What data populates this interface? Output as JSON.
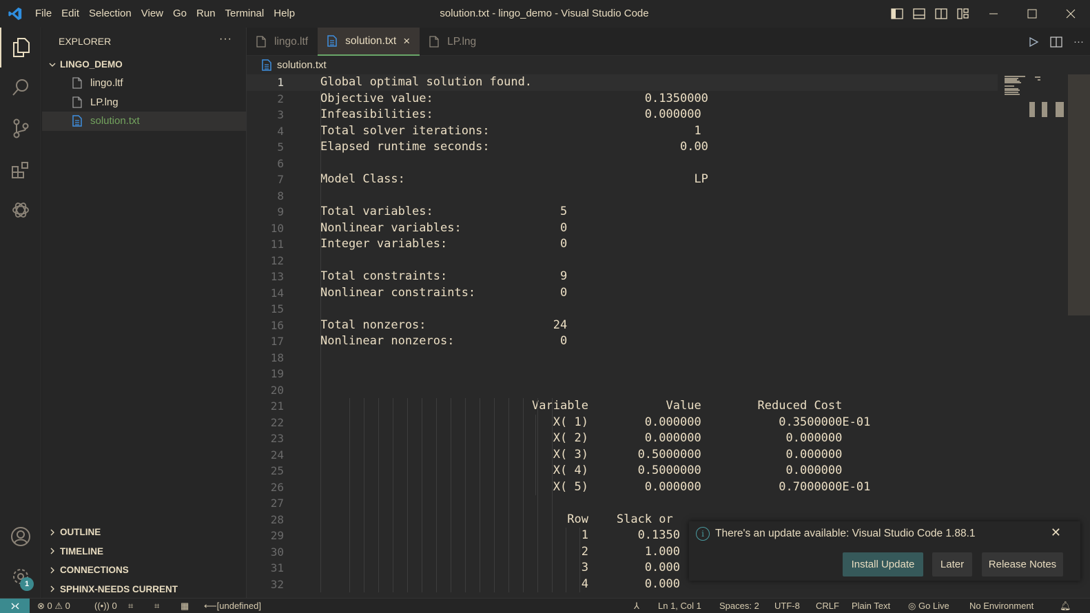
{
  "window": {
    "title": "solution.txt - lingo_demo - Visual Studio Code",
    "menu": [
      "File",
      "Edit",
      "Selection",
      "View",
      "Go",
      "Run",
      "Terminal",
      "Help"
    ]
  },
  "activity_bar": {
    "items": [
      "explorer-icon",
      "search-icon",
      "source-control-icon",
      "extensions-icon",
      "chatgpt-icon"
    ],
    "bottom": [
      "account-icon",
      "settings-gear-icon"
    ],
    "settings_badge": "1"
  },
  "sidebar": {
    "header": "EXPLORER",
    "more_label": "···",
    "folder": "LINGO_DEMO",
    "files": [
      {
        "name": "lingo.ltf",
        "selected": false
      },
      {
        "name": "LP.lng",
        "selected": false
      },
      {
        "name": "solution.txt",
        "selected": true
      }
    ],
    "sections": [
      "OUTLINE",
      "TIMELINE",
      "CONNECTIONS",
      "SPHINX-NEEDS CURRENT"
    ]
  },
  "tabs": [
    {
      "label": "lingo.ltf",
      "active": false
    },
    {
      "label": "solution.txt",
      "active": true,
      "close": "×"
    },
    {
      "label": "LP.lng",
      "active": false
    }
  ],
  "breadcrumb": "solution.txt",
  "editor": {
    "current_line": 1,
    "lines": [
      "Global optimal solution found.",
      "Objective value:                              0.1350000",
      "Infeasibilities:                              0.000000",
      "Total solver iterations:                             1",
      "Elapsed runtime seconds:                           0.00",
      "",
      "Model Class:                                         LP",
      "",
      "Total variables:                  5",
      "Nonlinear variables:              0",
      "Integer variables:                0",
      "",
      "Total constraints:                9",
      "Nonlinear constraints:            0",
      "",
      "Total nonzeros:                  24",
      "Nonlinear nonzeros:               0",
      "",
      "",
      "",
      "                              Variable           Value        Reduced Cost",
      "                                 X( 1)        0.000000           0.3500000E-01",
      "                                 X( 2)        0.000000            0.000000",
      "                                 X( 3)       0.5000000            0.000000",
      "                                 X( 4)       0.5000000            0.000000",
      "                                 X( 5)        0.000000           0.7000000E-01",
      "",
      "                                   Row    Slack or",
      "                                     1       0.1350",
      "                                     2        1.000",
      "                                     3        0.000",
      "                                     4        0.000"
    ]
  },
  "solution": {
    "objective_value": "0.1350000",
    "infeasibilities": "0.000000",
    "solver_iterations": "1",
    "runtime_seconds": "0.00",
    "model_class": "LP",
    "variables": [
      {
        "name": "X( 1)",
        "value": "0.000000",
        "reduced_cost": "0.3500000E-01"
      },
      {
        "name": "X( 2)",
        "value": "0.000000",
        "reduced_cost": "0.000000"
      },
      {
        "name": "X( 3)",
        "value": "0.5000000",
        "reduced_cost": "0.000000"
      },
      {
        "name": "X( 4)",
        "value": "0.5000000",
        "reduced_cost": "0.000000"
      },
      {
        "name": "X( 5)",
        "value": "0.000000",
        "reduced_cost": "0.7000000E-01"
      }
    ]
  },
  "notification": {
    "message": "There's an update available: Visual Studio Code 1.88.1",
    "buttons": [
      "Install Update",
      "Later",
      "Release Notes"
    ]
  },
  "statusbar": {
    "errors": "0",
    "warnings": "0",
    "ports": "0",
    "branch": "[undefined]",
    "position": "Ln 1, Col 1",
    "spaces": "Spaces: 2",
    "encoding": "UTF-8",
    "eol": "CRLF",
    "language": "Plain Text",
    "go_live": "Go Live",
    "environment": "No Environment"
  },
  "colors": {
    "accent_teal": "#3b8a8f",
    "selected_file_green": "#73a35e",
    "text_cream": "#e8dcc0",
    "primary_button": "#36595a"
  }
}
